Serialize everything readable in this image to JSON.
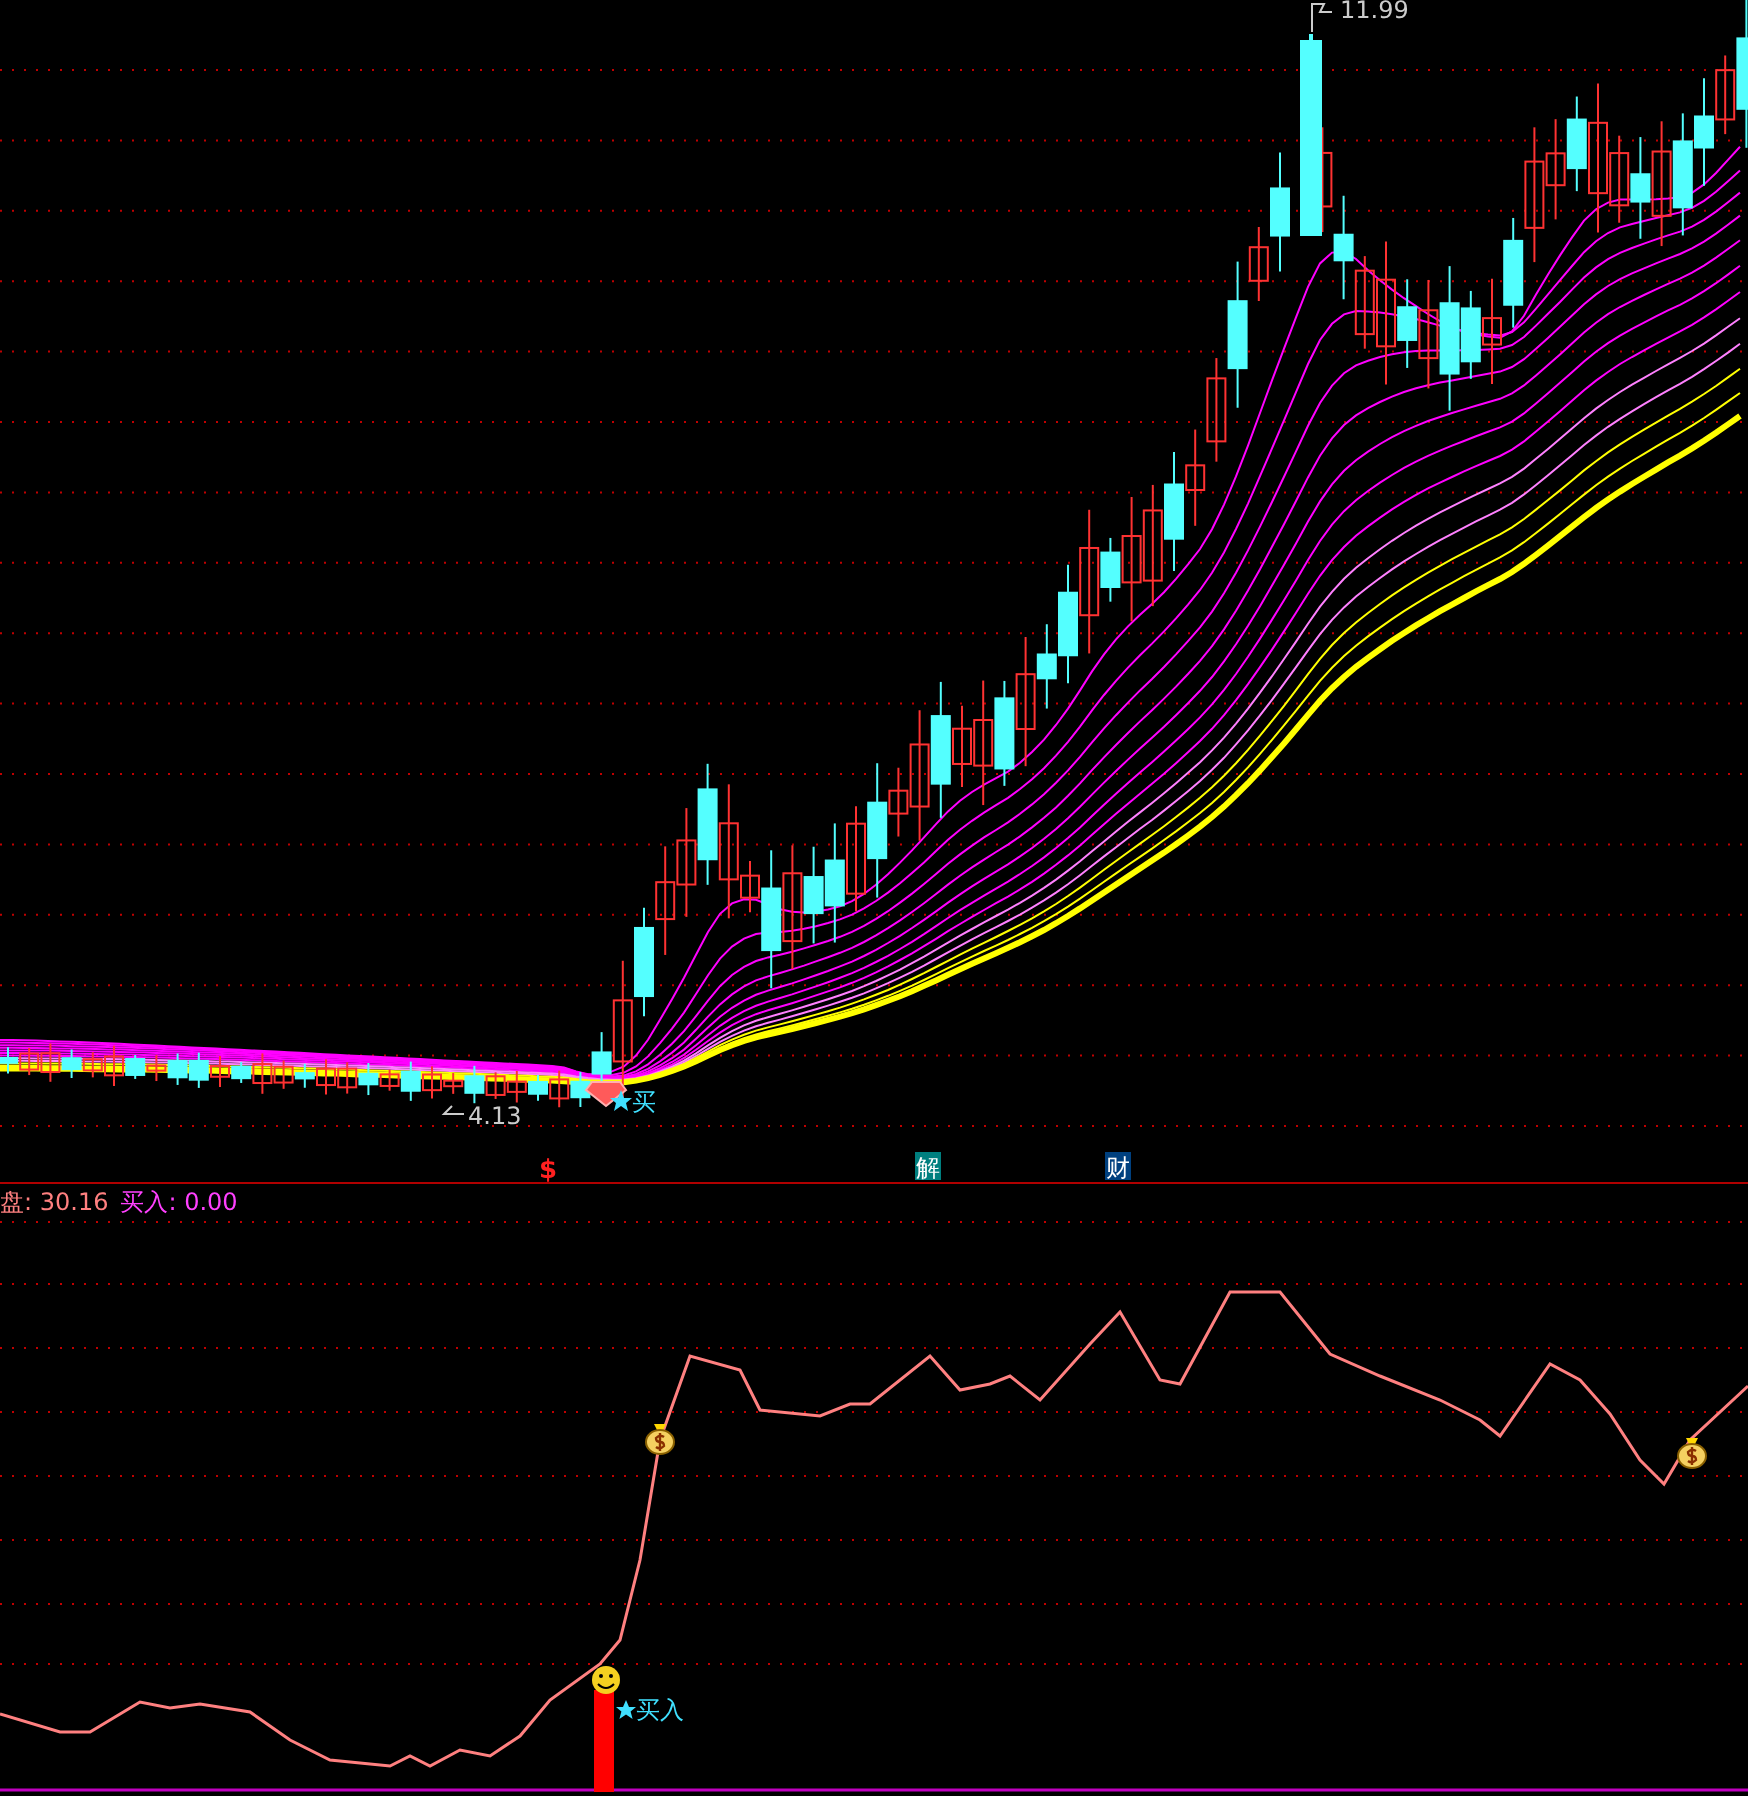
{
  "price_chart": {
    "high_label": "11.99",
    "low_label": "4.13",
    "buy_signal": "买"
  },
  "markers": [
    {
      "kind": "symbol",
      "text": "$"
    },
    {
      "kind": "badge",
      "text": "解",
      "color": "#007f7f"
    },
    {
      "kind": "badge",
      "text": "财",
      "color": "#00407f"
    }
  ],
  "indicator": {
    "legend": [
      {
        "text": "盘: 30.16",
        "color": "#ff8080"
      },
      {
        "text": "买入: 0.00",
        "color": "#ff40ff"
      }
    ],
    "buy_label": "买入"
  }
}
